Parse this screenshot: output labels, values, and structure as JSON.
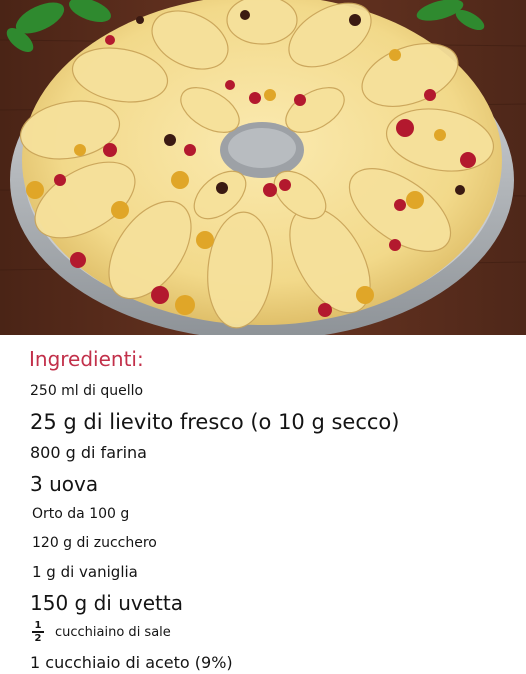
{
  "title": "Ingredienti:",
  "ingredients": [
    "250 ml di quello",
    "25 g di lievito fresco (o 10 g secco)",
    "800 g di farina",
    "3 uova",
    "Orto da 100 g",
    "120 g di zucchero",
    "1 g di vaniglia",
    "150 g di uvetta",
    "cucchiaino di sale",
    "1 cucchiaio di aceto (9%)"
  ],
  "salt_fraction": {
    "numerator": "1",
    "denominator": "2"
  },
  "colors": {
    "title": "#c2304a",
    "text": "#141414",
    "dough": "#f3dc8e",
    "cranberry": "#b3192e",
    "raisin": "#e0a628",
    "pan": "#b9bdc2",
    "wood": "#5a2c1c"
  }
}
